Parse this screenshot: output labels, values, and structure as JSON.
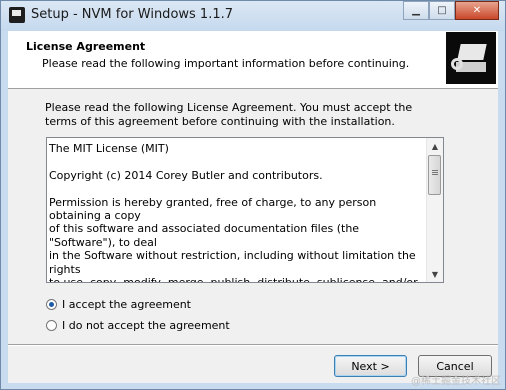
{
  "window": {
    "title": "Setup - NVM for Windows 1.1.7"
  },
  "header": {
    "title": "License Agreement",
    "subtitle": "Please read the following important information before continuing."
  },
  "intro": "Please read the following License Agreement. You must accept the terms of this agreement before continuing with the installation.",
  "license_text": "The MIT License (MIT)\n\nCopyright (c) 2014 Corey Butler and contributors.\n\nPermission is hereby granted, free of charge, to any person obtaining a copy\nof this software and associated documentation files (the \"Software\"), to deal\nin the Software without restriction, including without limitation the rights\nto use, copy, modify, merge, publish, distribute, sublicense, and/or sell\ncopies of the Software, and to permit persons to whom the Software is\nfurnished to do so, subject to the following conditions:",
  "options": [
    {
      "label": "I accept the agreement",
      "selected": true
    },
    {
      "label": "I do not accept the agreement",
      "selected": false
    }
  ],
  "buttons": {
    "next": "Next >",
    "cancel": "Cancel"
  },
  "watermark": "@稀土掘金技术社区"
}
